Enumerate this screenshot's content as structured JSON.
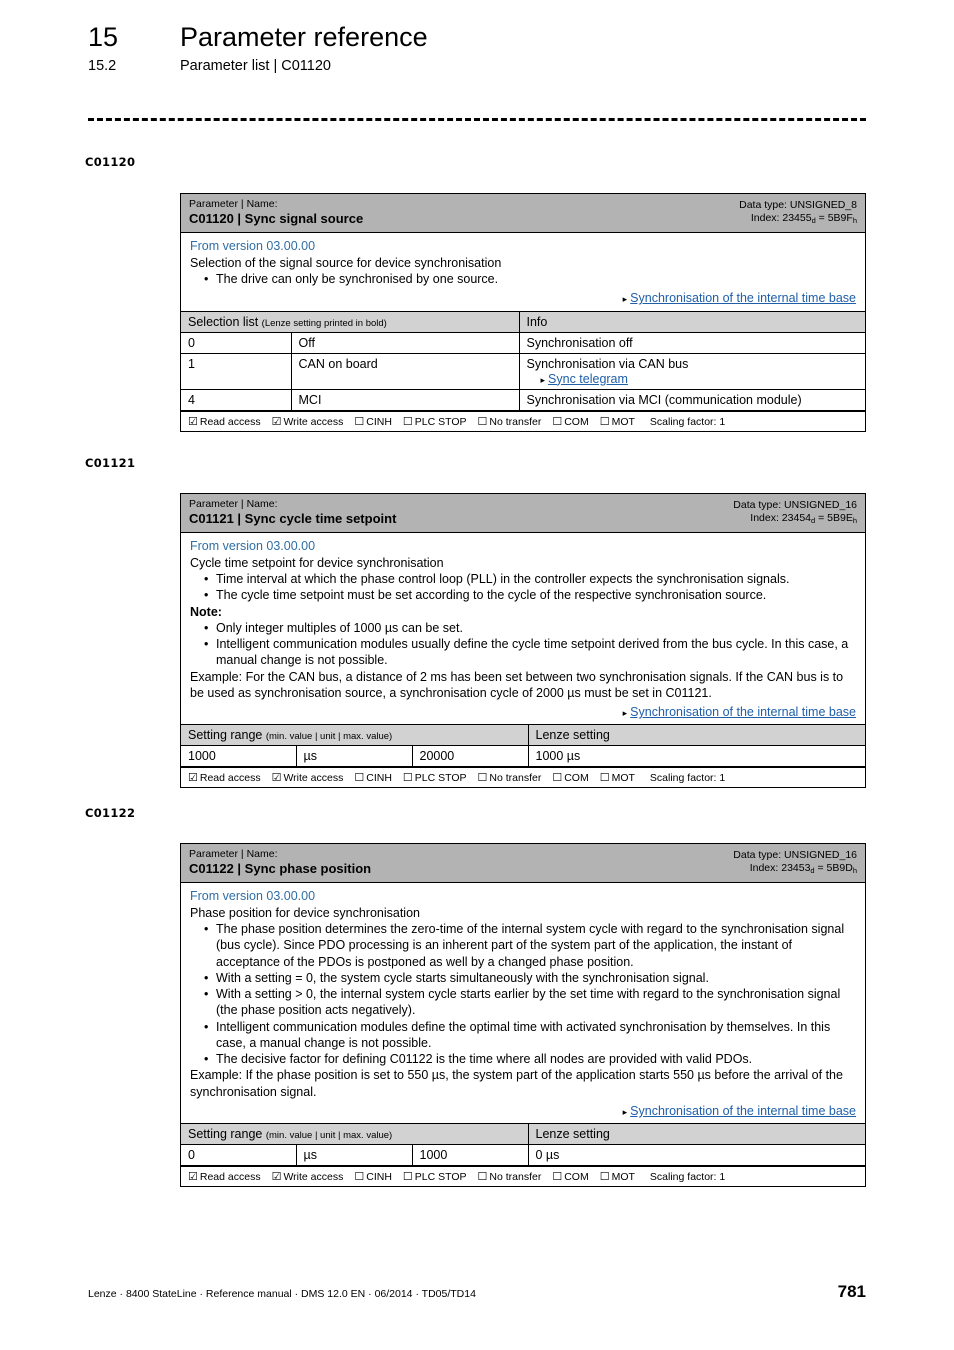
{
  "header": {
    "chapter_number": "15",
    "chapter_title": "Parameter reference",
    "section_number": "15.2",
    "section_title": "Parameter list | C01120"
  },
  "colors": {
    "title_bar": "#b3b3b3",
    "section_header": "#d2d2d2",
    "link": "#1f5fa9",
    "version_text": "#2f6ea5"
  },
  "access_labels": {
    "read": "Read access",
    "write": "Write access",
    "cinh": "CINH",
    "plc_stop": "PLC STOP",
    "no_transfer": "No transfer",
    "com": "COM",
    "mot": "MOT",
    "scaling": "Scaling factor: 1",
    "checked_glyph": "☑",
    "unchecked_glyph": "☐"
  },
  "blocks": [
    {
      "margin_label": "C01120",
      "title_small": "Parameter | Name:",
      "title_big": "C01120 | Sync signal source",
      "data_type": "Data type: UNSIGNED_8",
      "index_prefix": "Index: 23455",
      "index_sub1": "d",
      "index_mid": " = 5B9F",
      "index_sub2": "h",
      "from_version": "From version 03.00.00",
      "description": "Selection of the signal source for device synchronisation",
      "bullets": [
        "The drive can only be synchronised by one source."
      ],
      "xref": "Synchronisation of the internal time base",
      "table_type": "selection",
      "sec_header_main": "Selection list",
      "sec_header_note": "(Lenze setting printed in bold)",
      "sec_header_right": "Info",
      "rows": [
        {
          "value": "0",
          "name": "Off",
          "bold": true,
          "info": "Synchronisation off",
          "info_link": ""
        },
        {
          "value": "1",
          "name": "CAN on board",
          "bold": false,
          "info": "Synchronisation via CAN bus",
          "info_link": "Sync telegram"
        },
        {
          "value": "4",
          "name": "MCI",
          "bold": false,
          "info": "Synchronisation via MCI (communication module)",
          "info_link": ""
        }
      ]
    },
    {
      "margin_label": "C01121",
      "title_small": "Parameter | Name:",
      "title_big": "C01121 | Sync cycle time setpoint",
      "data_type": "Data type: UNSIGNED_16",
      "index_prefix": "Index: 23454",
      "index_sub1": "d",
      "index_mid": " = 5B9E",
      "index_sub2": "h",
      "from_version": "From version 03.00.00",
      "description": "Cycle time setpoint for device synchronisation",
      "bullets": [
        "Time interval at which the phase control loop (PLL) in the controller expects the synchronisation signals.",
        "The cycle time setpoint must be set according to the cycle of the respective synchronisation source."
      ],
      "note_label": "Note:",
      "note_bullets": [
        "Only integer multiples of 1000 µs can be set.",
        "Intelligent communication modules usually define the cycle time setpoint derived from the bus cycle. In this case, a manual change is not possible."
      ],
      "example": "Example: For the CAN bus, a distance of 2 ms has been set between two synchronisation signals. If the CAN bus is to be used as synchronisation source, a synchronisation cycle of 2000 µs must be set in C01121.",
      "xref": "Synchronisation of the internal time base",
      "table_type": "range",
      "sec_header_main": "Setting range",
      "sec_header_note": "(min. value | unit | max. value)",
      "sec_header_right": "Lenze setting",
      "range": {
        "min": "1000",
        "unit": "µs",
        "max": "20000",
        "lenze": "1000 µs"
      }
    },
    {
      "margin_label": "C01122",
      "title_small": "Parameter | Name:",
      "title_big": "C01122 | Sync phase position",
      "data_type": "Data type: UNSIGNED_16",
      "index_prefix": "Index: 23453",
      "index_sub1": "d",
      "index_mid": " = 5B9D",
      "index_sub2": "h",
      "from_version": "From version 03.00.00",
      "description": "Phase position for device synchronisation",
      "bullets": [
        "The phase position determines the zero-time of the internal system cycle with regard to the synchronisation signal (bus cycle). Since PDO processing is an inherent part of the system part of the application, the instant of acceptance of the PDOs is postponed as well by a changed phase position.",
        "With a setting = 0, the system cycle starts simultaneously with the synchronisation signal.",
        "With a setting > 0, the internal system cycle starts earlier by the set time with regard to the synchronisation signal (the phase position acts negatively).",
        "Intelligent communication modules define the optimal time with activated synchronisation by themselves. In this case, a manual change is not possible.",
        "The decisive factor for defining C01122 is the time where all nodes are provided with valid PDOs."
      ],
      "example": "Example: If the phase position is set to 550 µs, the system part of the application starts 550 µs before the arrival of the synchronisation signal.",
      "xref": "Synchronisation of the internal time base",
      "table_type": "range",
      "sec_header_main": "Setting range",
      "sec_header_note": "(min. value | unit | max. value)",
      "sec_header_right": "Lenze setting",
      "range": {
        "min": "0",
        "unit": "µs",
        "max": "1000",
        "lenze": "0 µs"
      }
    }
  ],
  "footer": {
    "text": "Lenze · 8400 StateLine · Reference manual · DMS 12.0 EN · 06/2014 · TD05/TD14",
    "page_number": "781"
  }
}
